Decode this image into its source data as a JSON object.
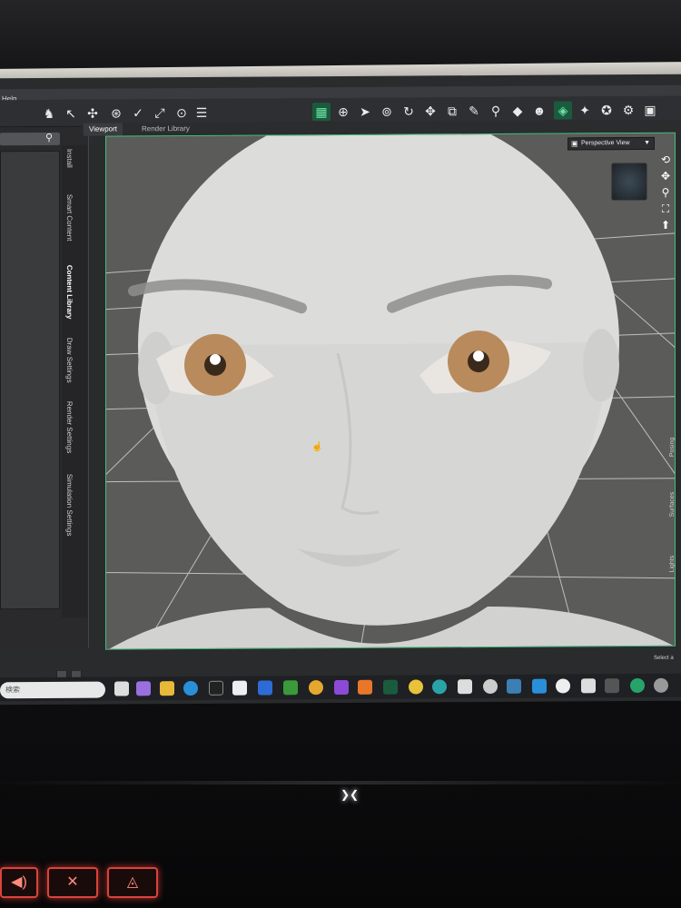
{
  "menu": {
    "help_label": "Help"
  },
  "viewport_tabs": [
    "Viewport",
    "Render Library"
  ],
  "left_tabs": [
    "Install",
    "Smart Content",
    "Content Library",
    "Draw Settings",
    "Render Settings",
    "Simulation Settings"
  ],
  "right_tabs": [
    "Posing",
    "Surfaces",
    "Lights"
  ],
  "viewport": {
    "camera_label": "Perspective View"
  },
  "taskbar": {
    "search_placeholder": "検索"
  },
  "status": {
    "select_label": "Select a"
  },
  "colors": {
    "accent": "#3fbf7f",
    "viewport_bg": "#5a5a58",
    "face": "#dcdcda"
  }
}
